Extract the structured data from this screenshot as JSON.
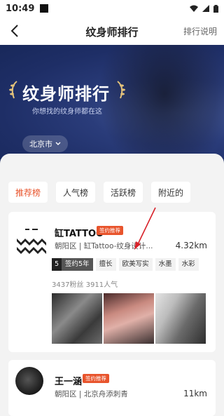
{
  "status_bar": {
    "time": "10:49"
  },
  "nav": {
    "title": "纹身师排行",
    "right_link": "排行说明"
  },
  "hero": {
    "title": "纹身师排行",
    "subtitle": "你想找的纹身师都在这",
    "city": "北京市"
  },
  "tabs": [
    {
      "label": "推荐榜",
      "active": true
    },
    {
      "label": "人气榜",
      "active": false
    },
    {
      "label": "活跃榜",
      "active": false
    },
    {
      "label": "附近的",
      "active": false
    }
  ],
  "cards": [
    {
      "name": "缸TATTOO",
      "badge": "签约推荐",
      "address": "朝阳区 | 缸Tattoo-纹身设计...",
      "distance": "4.32km",
      "years_num": "5",
      "years_text": "签约5年",
      "tags": [
        "擅长",
        "欧美写实",
        "水墨",
        "水彩"
      ],
      "stats": "3437粉丝  3911人气"
    },
    {
      "name": "王一涵",
      "badge": "签约推荐",
      "address": "朝阳区 | 北京舟添刺青",
      "distance": "11km"
    }
  ],
  "colors": {
    "accent": "#e8542c",
    "hero_bg": "#1e2e66"
  }
}
